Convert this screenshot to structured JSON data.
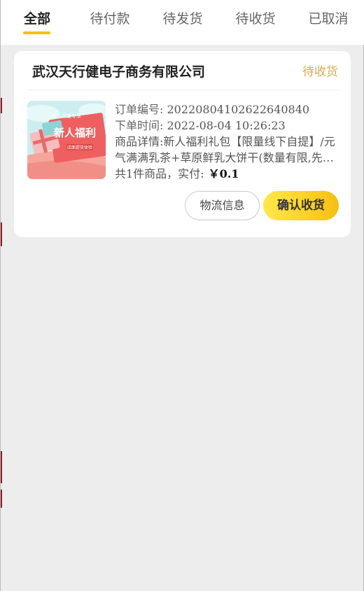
{
  "tabs": [
    {
      "label": "全部",
      "active": true
    },
    {
      "label": "待付款",
      "active": false
    },
    {
      "label": "待发货",
      "active": false
    },
    {
      "label": "待收货",
      "active": false
    },
    {
      "label": "已取消",
      "active": false
    }
  ],
  "order": {
    "shop_name": "武汉天行健电子商务有限公司",
    "status": "待收货",
    "order_no_label": "订单编号:",
    "order_no": "20220804102622640840",
    "order_time_label": "下单时间:",
    "order_time": "2022-08-04 10:26:23",
    "detail_label": "商品详情:",
    "detail": "新人福利礼包【限量线下自提】/元气满满乳茶+草原鲜乳大饼干(数量有限,先到先得)",
    "total_text": "共1件商品，实付:",
    "price": "￥0.1",
    "thumbnail": {
      "top_text": "新人限量专享",
      "main_text": "新人福利",
      "sub_text": "店面提货体验"
    }
  },
  "buttons": {
    "logistics": "物流信息",
    "confirm": "确认收货"
  },
  "colors": {
    "accent": "#f5c000",
    "status": "#e0a84a",
    "background": "#ededed",
    "confirm_button": "#fdd22a"
  }
}
